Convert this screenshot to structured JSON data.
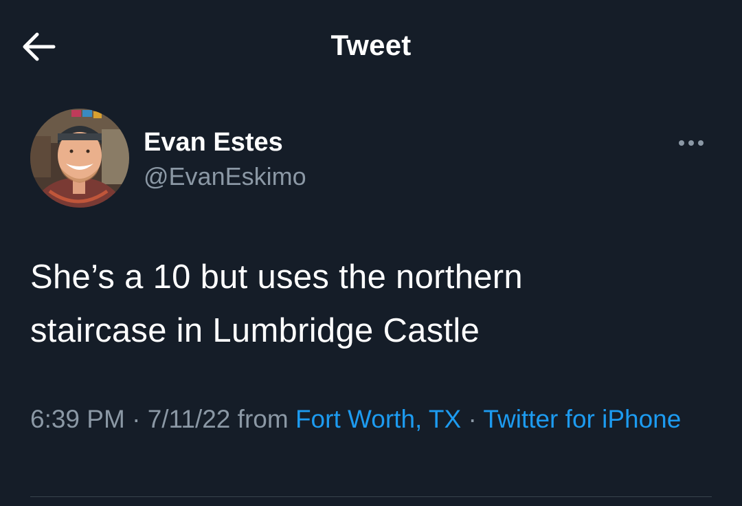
{
  "header": {
    "title": "Tweet",
    "back_icon": "arrow-left-icon"
  },
  "tweet": {
    "author": {
      "display_name": "Evan Estes",
      "handle": "@EvanEskimo"
    },
    "more_icon": "more-horizontal-icon",
    "text_lines": [
      "She’s a 10 but uses the northern",
      "staircase in Lumbridge Castle"
    ],
    "meta": {
      "time": "6:39 PM",
      "separator_1": " · ",
      "date": "7/11/22",
      "from_label": " from ",
      "location": "Fort Worth, TX",
      "separator_2": " · ",
      "source": "Twitter for iPhone"
    }
  },
  "colors": {
    "background": "#151d28",
    "text_primary": "#ffffff",
    "text_secondary": "#8b98a5",
    "link": "#1d9bf0",
    "divider": "#38444d"
  }
}
